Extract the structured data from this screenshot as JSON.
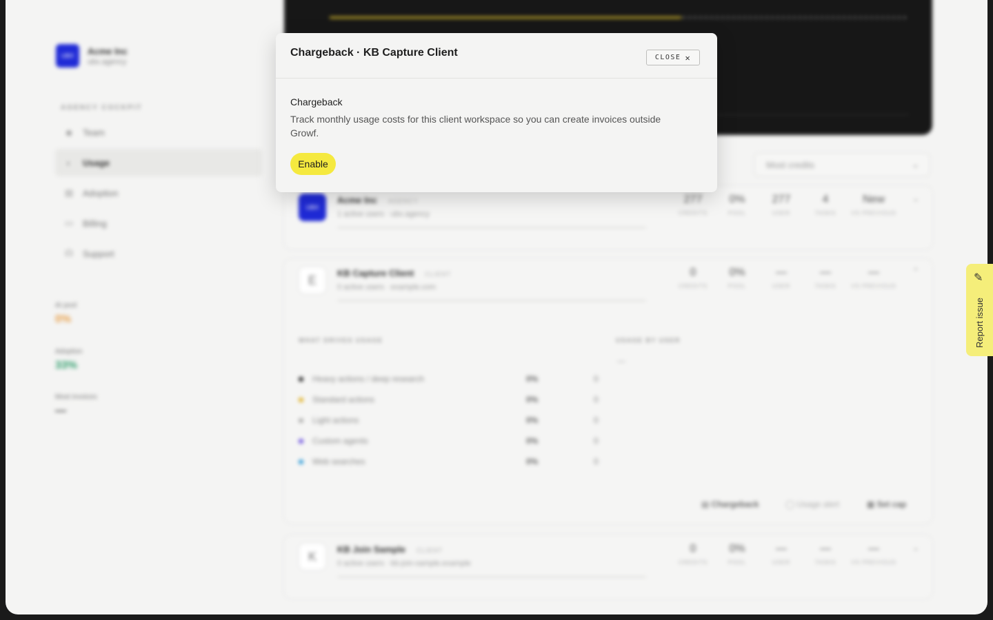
{
  "sidebar": {
    "brand_logo": "UBX",
    "brand_name": "Acme Inc",
    "brand_sub": "ubx.agency",
    "section_label": "AGENCY COCKPIT",
    "items": [
      {
        "label": "Team",
        "icon": "users-icon"
      },
      {
        "label": "Usage",
        "icon": "gauge-icon"
      },
      {
        "label": "Adoption",
        "icon": "chart-icon"
      },
      {
        "label": "Billing",
        "icon": "card-icon"
      },
      {
        "label": "Support",
        "icon": "headset-icon"
      }
    ],
    "stats": [
      {
        "label": "AI pool",
        "value": "0%",
        "color": "#e8a04a"
      },
      {
        "label": "Adoption",
        "value": "33%",
        "color": "#2e9d6b"
      },
      {
        "label": "Most invoices",
        "value": "—",
        "color": "#333333"
      }
    ]
  },
  "sort_select": "Most credits",
  "workspaces": [
    {
      "avatar": "UBX",
      "name": "Acme Inc",
      "tag": "AGENCY",
      "meta": "1 active users · ubx.agency",
      "stats": [
        {
          "value": "277",
          "label": "CREDITS"
        },
        {
          "value": "0%",
          "label": "POOL"
        },
        {
          "value": "277",
          "label": "USER"
        },
        {
          "value": "4",
          "label": "TASKS"
        },
        {
          "value": "New",
          "label": "VS PREVIOUS"
        }
      ]
    },
    {
      "avatar": "E",
      "name": "KB Capture Client",
      "tag": "CLIENT",
      "meta": "0 active users · example.com",
      "stats": [
        {
          "value": "0",
          "label": "CREDITS"
        },
        {
          "value": "0%",
          "label": "POOL"
        },
        {
          "value": "—",
          "label": "USER"
        },
        {
          "value": "—",
          "label": "TASKS"
        },
        {
          "value": "—",
          "label": "VS PREVIOUS"
        }
      ]
    },
    {
      "avatar": "K",
      "name": "KB Join Sample",
      "tag": "CLIENT",
      "meta": "0 active users · kb-join-sample.example",
      "stats": [
        {
          "value": "0",
          "label": "CREDITS"
        },
        {
          "value": "0%",
          "label": "POOL"
        },
        {
          "value": "—",
          "label": "USER"
        },
        {
          "value": "—",
          "label": "TASKS"
        },
        {
          "value": "—",
          "label": "VS PREVIOUS"
        }
      ]
    }
  ],
  "drivers": {
    "heading": "WHAT DRIVES USAGE",
    "users_heading": "USAGE BY USER",
    "users_empty": "—",
    "rows": [
      {
        "label": "Heavy actions / deep research",
        "pct": "0%",
        "n": "0",
        "color": "#222222"
      },
      {
        "label": "Standard actions",
        "pct": "0%",
        "n": "0",
        "color": "#e0b020"
      },
      {
        "label": "Light actions",
        "pct": "0%",
        "n": "0",
        "color": "#aaaaaa"
      },
      {
        "label": "Custom agents",
        "pct": "0%",
        "n": "0",
        "color": "#6a4fe0"
      },
      {
        "label": "Web searches",
        "pct": "0%",
        "n": "0",
        "color": "#2a9ad8"
      }
    ],
    "actions": {
      "chargeback": "Chargeback",
      "alert": "Usage alert",
      "cap": "Set cap"
    }
  },
  "report_issue": "Report issue",
  "modal": {
    "title": "Chargeback · KB Capture Client",
    "close_label": "CLOSE",
    "heading": "Chargeback",
    "description": "Track monthly usage costs for this client workspace so you can create invoices outside Growf.",
    "enable_label": "Enable"
  }
}
